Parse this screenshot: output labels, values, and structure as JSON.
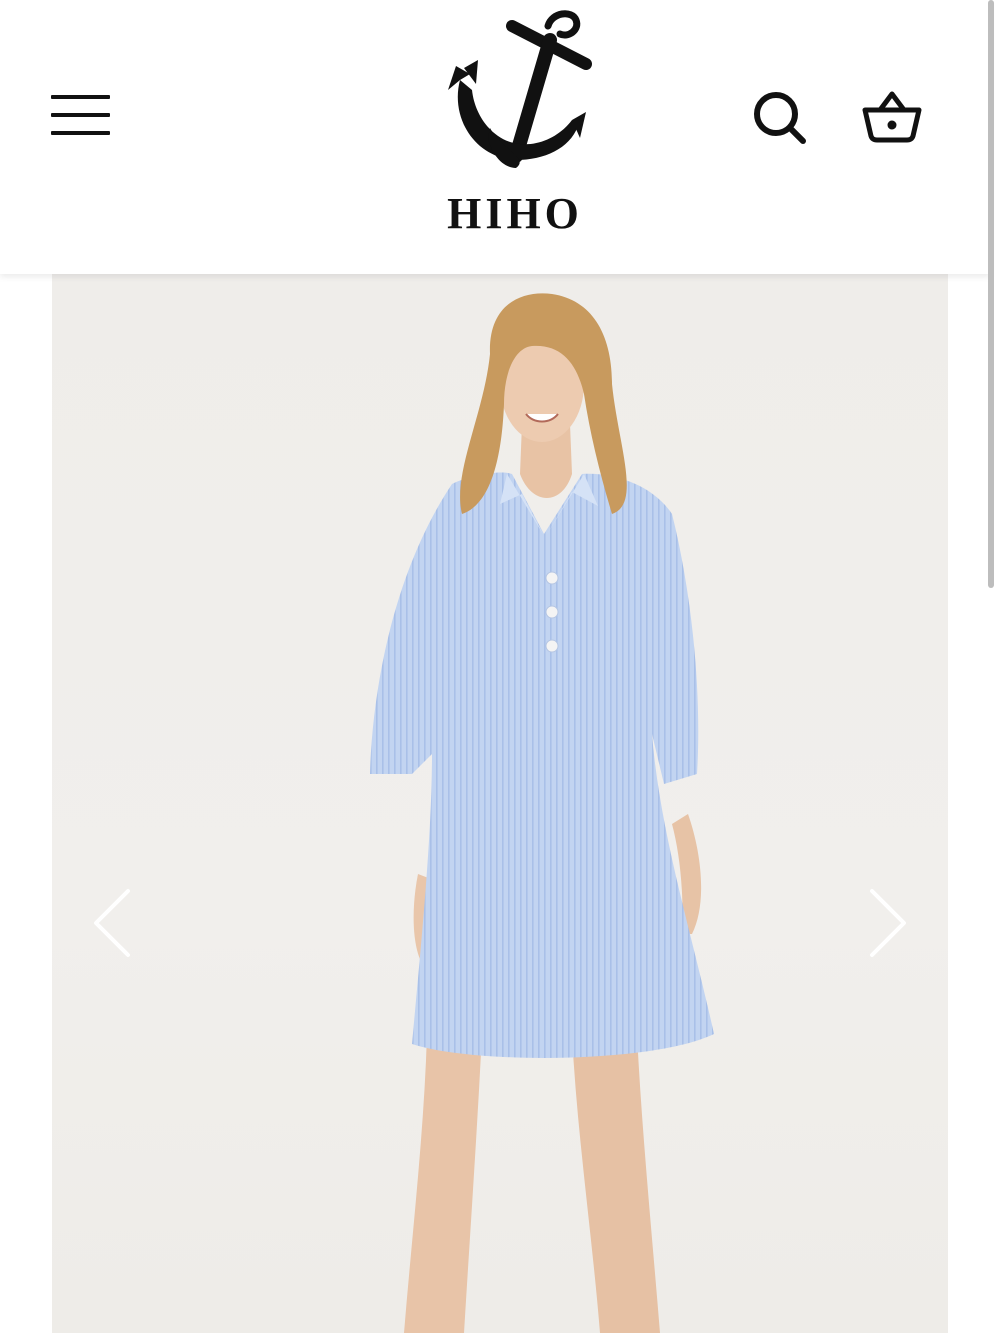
{
  "header": {
    "brand": "HIHO",
    "menu_icon": "hamburger-menu-icon",
    "logo_icon": "anchor-icon",
    "search_icon": "search-icon",
    "cart_icon": "basket-icon"
  },
  "gallery": {
    "image_subject": "model-wearing-blue-striped-shirt-dress",
    "prev_icon": "chevron-left-icon",
    "next_icon": "chevron-right-icon"
  },
  "colors": {
    "dress": "#b9cdee",
    "background": "#efedea",
    "icon": "#111111"
  }
}
